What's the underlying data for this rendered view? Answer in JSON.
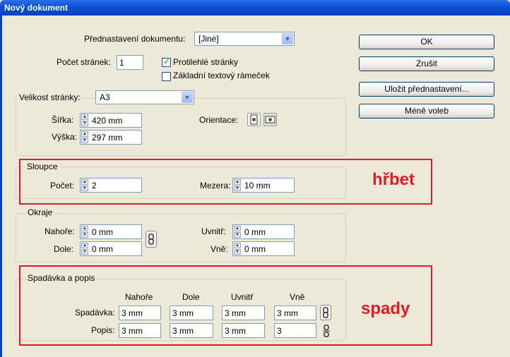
{
  "window": {
    "title": "Nový dokument"
  },
  "preset": {
    "label": "Přednastavení dokumentu:",
    "value": "[Jiné]"
  },
  "pages": {
    "label": "Počet stránek:",
    "value": "1"
  },
  "facing_pages": {
    "label": "Protilehlé stránky",
    "checked": true
  },
  "master_text_frame": {
    "label": "Základní textový rámeček",
    "checked": false
  },
  "page_size": {
    "label": "Velikost stránky:",
    "value": "A3",
    "width_label": "Šířka:",
    "width": "420 mm",
    "height_label": "Výška:",
    "height": "297 mm",
    "orientation_label": "Orientace:"
  },
  "columns": {
    "title": "Sloupce",
    "count_label": "Počet:",
    "count": "2",
    "gutter_label": "Mezera:",
    "gutter": "10 mm"
  },
  "margins": {
    "title": "Okraje",
    "top_label": "Nahoře:",
    "top": "0 mm",
    "bottom_label": "Dole:",
    "bottom": "0 mm",
    "inside_label": "Uvnitř:",
    "inside": "0 mm",
    "outside_label": "Vně:",
    "outside": "0 mm"
  },
  "bleed_slug": {
    "title": "Spadávka a popis",
    "headers": [
      "Nahoře",
      "Dole",
      "Uvnitř",
      "Vně"
    ],
    "bleed_label": "Spadávka:",
    "bleed": [
      "3 mm",
      "3 mm",
      "3 mm",
      "3 mm"
    ],
    "slug_label": "Popis:",
    "slug": [
      "3 mm",
      "3 mm",
      "3 mm",
      "3"
    ]
  },
  "buttons": {
    "ok": "OK",
    "cancel": "Zrušit",
    "save_preset": "Uložit přednastavení...",
    "fewer_options": "Méně voleb"
  },
  "annotations": {
    "spine": "hřbet",
    "bleeds": "spady"
  },
  "colors": {
    "annotation_red": "#e31b23",
    "dialog_bg": "#ece9d8",
    "title_blue": "#0a4fd8"
  }
}
